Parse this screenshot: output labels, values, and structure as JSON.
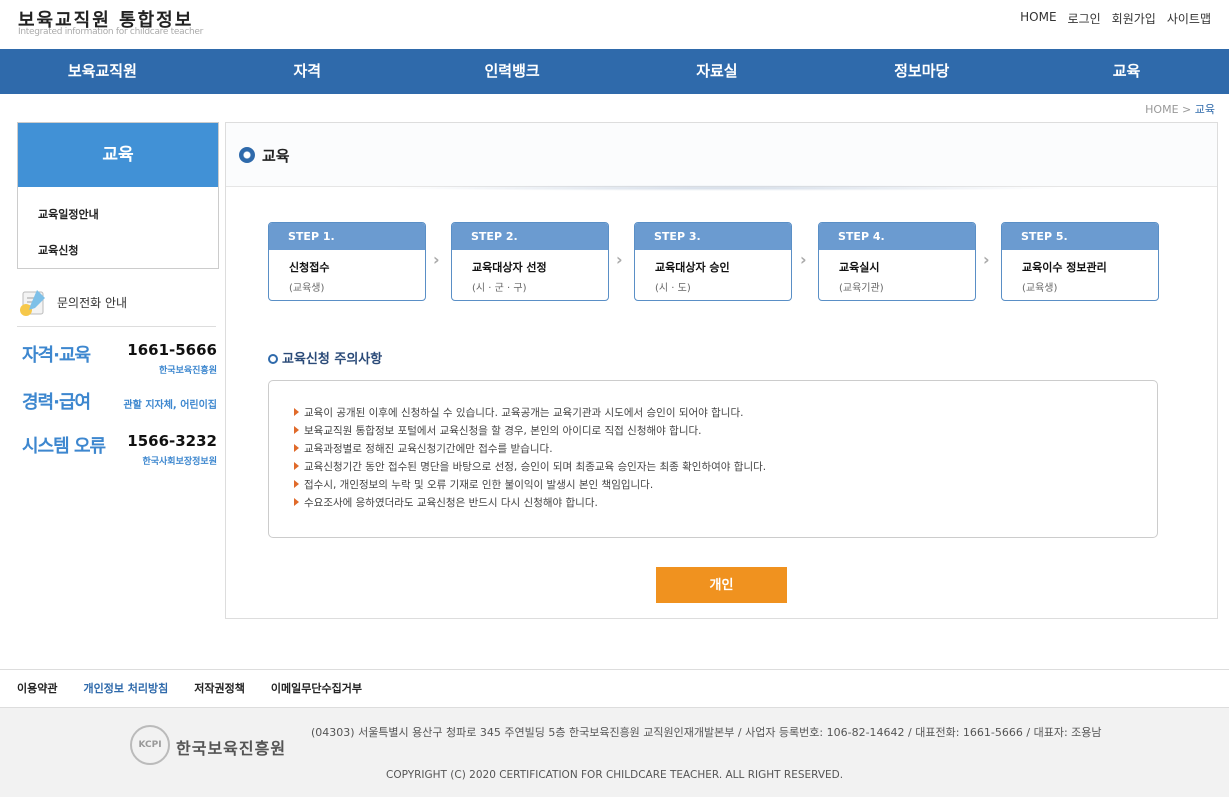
{
  "header": {
    "logo_ko": "보육교직원 통합정보",
    "logo_en": "Integrated information for childcare teacher",
    "util": [
      "HOME",
      "로그인",
      "회원가입",
      "사이트맵"
    ]
  },
  "gnb": [
    "보육교직원",
    "자격",
    "인력뱅크",
    "자료실",
    "정보마당",
    "교육"
  ],
  "breadcrumb": {
    "home": "HOME",
    "sep": ">",
    "current": "교육"
  },
  "lnb": {
    "title": "교육",
    "items": [
      "교육일정안내",
      "교육신청"
    ]
  },
  "contact": {
    "label": "문의전화 안내",
    "rows": [
      {
        "name": "자격·교육",
        "phone": "1661-5666",
        "org": "한국보육진흥원"
      },
      {
        "name": "경력·급여",
        "phone": "",
        "org": "관할 지자체, 어린이집"
      },
      {
        "name": "시스템 오류",
        "phone": "1566-3232",
        "org": "한국사회보장정보원"
      }
    ]
  },
  "content": {
    "title": "교육",
    "steps": [
      {
        "label": "STEP 1.",
        "title": "신청접수",
        "sub": "(교육생)"
      },
      {
        "label": "STEP 2.",
        "title": "교육대상자 선정",
        "sub": "(시 · 군 · 구)"
      },
      {
        "label": "STEP 3.",
        "title": "교육대상자 승인",
        "sub": "(시 · 도)"
      },
      {
        "label": "STEP 4.",
        "title": "교육실시",
        "sub": "(교육기관)"
      },
      {
        "label": "STEP 5.",
        "title": "교육이수 정보관리",
        "sub": "(교육생)"
      }
    ],
    "notice_title": "교육신청 주의사항",
    "notices": [
      "교육이 공개된 이후에 신청하실 수 있습니다. 교육공개는 교육기관과 시도에서 승인이 되어야 합니다.",
      "보육교직원 통합정보 포털에서 교육신청을 할 경우, 본인의 아이디로 직접 신청해야 합니다.",
      "교육과정별로 정해진 교육신청기간에만 접수를 받습니다.",
      "교육신청기간 동안 접수된 명단을 바탕으로 선정, 승인이 되며 최종교육 승인자는 최종 확인하여야 합니다.",
      "접수시, 개인정보의 누락 및 오류 기재로 인한 불이익이 발생시 본인 책임입니다.",
      "수요조사에 응하였더라도 교육신청은 반드시 다시 신청해야 합니다."
    ],
    "button": "개인"
  },
  "footer": {
    "links": [
      "이용약관",
      "개인정보 처리방침",
      "저작권정책",
      "이메일무단수집거부"
    ],
    "logo_mark": "KCPI",
    "logo_name": "한국보육진흥원",
    "address": "(04303) 서울특별시 용산구 청파로 345 주연빌딩 5층 한국보육진흥원 교직원인재개발본부 / 사업자 등록번호: 106-82-14642 / 대표전화: 1661-5666 / 대표자: 조용남",
    "copyright": "COPYRIGHT (C) 2020 CERTIFICATION FOR CHILDCARE TEACHER. ALL RIGHT RESERVED."
  }
}
